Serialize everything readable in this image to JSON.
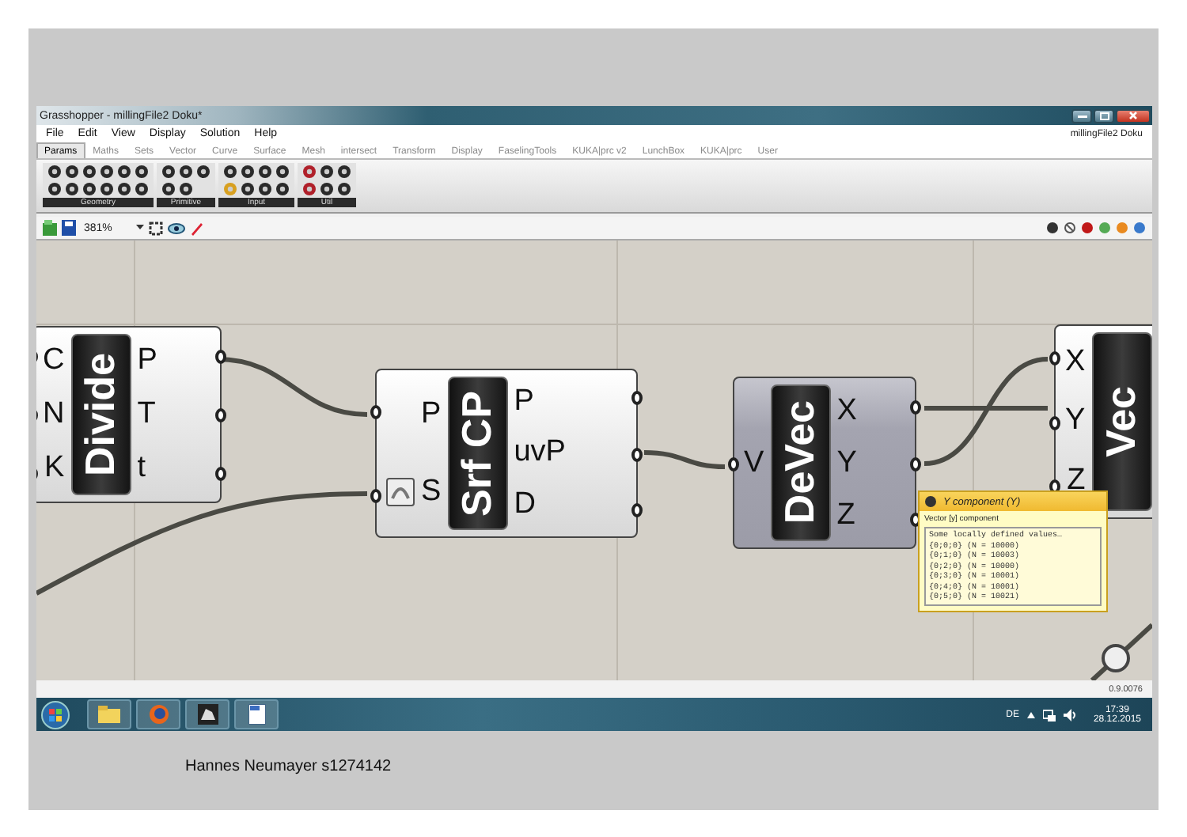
{
  "window": {
    "title": "Grasshopper - millingFile2 Doku*",
    "document_name": "millingFile2 Doku"
  },
  "menu": [
    "File",
    "Edit",
    "View",
    "Display",
    "Solution",
    "Help"
  ],
  "tabs": [
    {
      "label": "Params",
      "selected": true
    },
    {
      "label": "Maths",
      "selected": false
    },
    {
      "label": "Sets",
      "selected": false
    },
    {
      "label": "Vector",
      "selected": false
    },
    {
      "label": "Curve",
      "selected": false
    },
    {
      "label": "Surface",
      "selected": false
    },
    {
      "label": "Mesh",
      "selected": false
    },
    {
      "label": "intersect",
      "selected": false
    },
    {
      "label": "Transform",
      "selected": false
    },
    {
      "label": "Display",
      "selected": false
    },
    {
      "label": "FaselingTools",
      "selected": false
    },
    {
      "label": "KUKA|prc v2",
      "selected": false
    },
    {
      "label": "LunchBox",
      "selected": false
    },
    {
      "label": "KUKA|prc",
      "selected": false
    },
    {
      "label": "User",
      "selected": false
    }
  ],
  "ribbon_groups": [
    "Geometry",
    "Primitive",
    "Input",
    "Util"
  ],
  "toolbar": {
    "zoom": "381%"
  },
  "canvas": {
    "nodes": [
      {
        "name": "Divide",
        "hovered": false,
        "inputs": [
          {
            "label": "C",
            "kind": "plain"
          },
          {
            "label": "N",
            "kind": "plain"
          },
          {
            "label": "K",
            "kind": "plain"
          }
        ],
        "outputs": [
          "P",
          "T",
          "t"
        ]
      },
      {
        "name": "Srf CP",
        "hovered": false,
        "inputs": [
          {
            "label": "P",
            "kind": "plain"
          },
          {
            "label": "S",
            "kind": "surface"
          }
        ],
        "outputs": [
          "P",
          "uvP",
          "D"
        ]
      },
      {
        "name": "DeVec",
        "hovered": true,
        "inputs": [
          {
            "label": "V",
            "kind": "plain"
          }
        ],
        "outputs": [
          "X",
          "Y",
          "Z"
        ]
      },
      {
        "name": "Vec",
        "hovered": false,
        "inputs": [
          {
            "label": "X",
            "kind": "plain"
          },
          {
            "label": "Y",
            "kind": "plain"
          },
          {
            "label": "Z",
            "kind": "plain"
          }
        ]
      }
    ],
    "tooltip": {
      "title": "Y component (Y)",
      "description": "Vector [y] component",
      "heading": "Some locally defined values…",
      "values": [
        "{0;0;0} (N = 10000)",
        "{0;1;0} (N = 10003)",
        "{0;2;0} (N = 10000)",
        "{0;3;0} (N = 10001)",
        "{0;4;0} (N = 10001)",
        "{0;5;0} (N = 10021)"
      ]
    }
  },
  "status_bar": {
    "version": "0.9.0076"
  },
  "taskbar": {
    "language": "DE",
    "time": "17:39",
    "date": "28.12.2015"
  },
  "caption": "Hannes Neumayer s1274142"
}
